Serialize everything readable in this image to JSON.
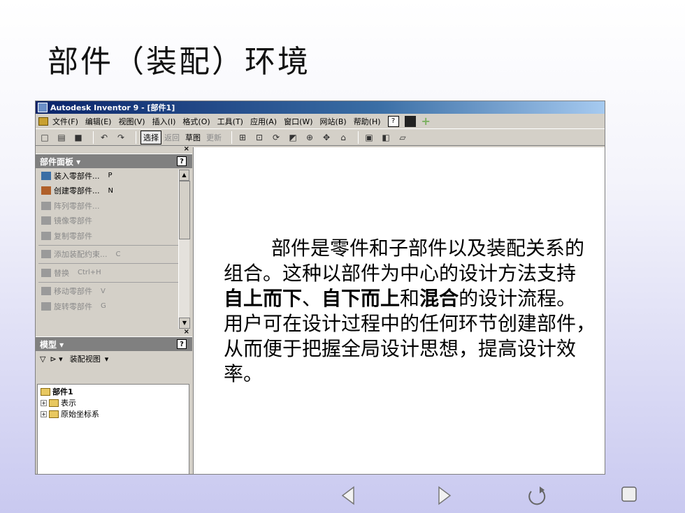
{
  "slide": {
    "title": "部件（装配）环境",
    "body_line1": "部件是零件和子部件以及装配关系的",
    "body_line2": "组合。这种以部件为中心的设计方法支持",
    "body_line3a": "自上而下",
    "body_line3b": "、",
    "body_line3c": "自下而上",
    "body_line3d": "和",
    "body_line3e": "混合",
    "body_line3f": "的设计流程。",
    "body_line4": "用户可在设计过程中的任何环节创建部件，",
    "body_line5": "从而便于把握全局设计思想，提高设计效",
    "body_line6": "率。"
  },
  "app": {
    "title": "Autodesk Inventor 9 - [部件1]",
    "menu": [
      "文件(F)",
      "编辑(E)",
      "视图(V)",
      "插入(I)",
      "格式(O)",
      "工具(T)",
      "应用(A)",
      "窗口(W)",
      "网站(B)",
      "帮助(H)"
    ],
    "toolbar": {
      "select": "选择",
      "back": "返回",
      "sketch": "草图",
      "update": "更新"
    },
    "parts_panel": {
      "title": "部件面板 ▾",
      "items": [
        {
          "label": "装入零部件...",
          "key": "P",
          "disabled": false
        },
        {
          "label": "创建零部件...",
          "key": "N",
          "disabled": false
        },
        {
          "label": "阵列零部件...",
          "key": "",
          "disabled": true
        },
        {
          "label": "镜像零部件",
          "key": "",
          "disabled": true
        },
        {
          "label": "复制零部件",
          "key": "",
          "disabled": true
        },
        {
          "label": "添加装配约束...",
          "key": "C",
          "disabled": true
        },
        {
          "label": "替换",
          "key": "Ctrl+H",
          "disabled": true
        },
        {
          "label": "移动零部件",
          "key": "V",
          "disabled": true
        },
        {
          "label": "旋转零部件",
          "key": "G",
          "disabled": true
        }
      ]
    },
    "model_panel": {
      "title": "模型 ▾",
      "view_label": "装配视图",
      "tree": {
        "root": "部件1",
        "children": [
          "表示",
          "原始坐标系"
        ]
      }
    }
  },
  "nav": {
    "prev": "◁",
    "next": "▷",
    "return": "↻",
    "end": "□"
  }
}
